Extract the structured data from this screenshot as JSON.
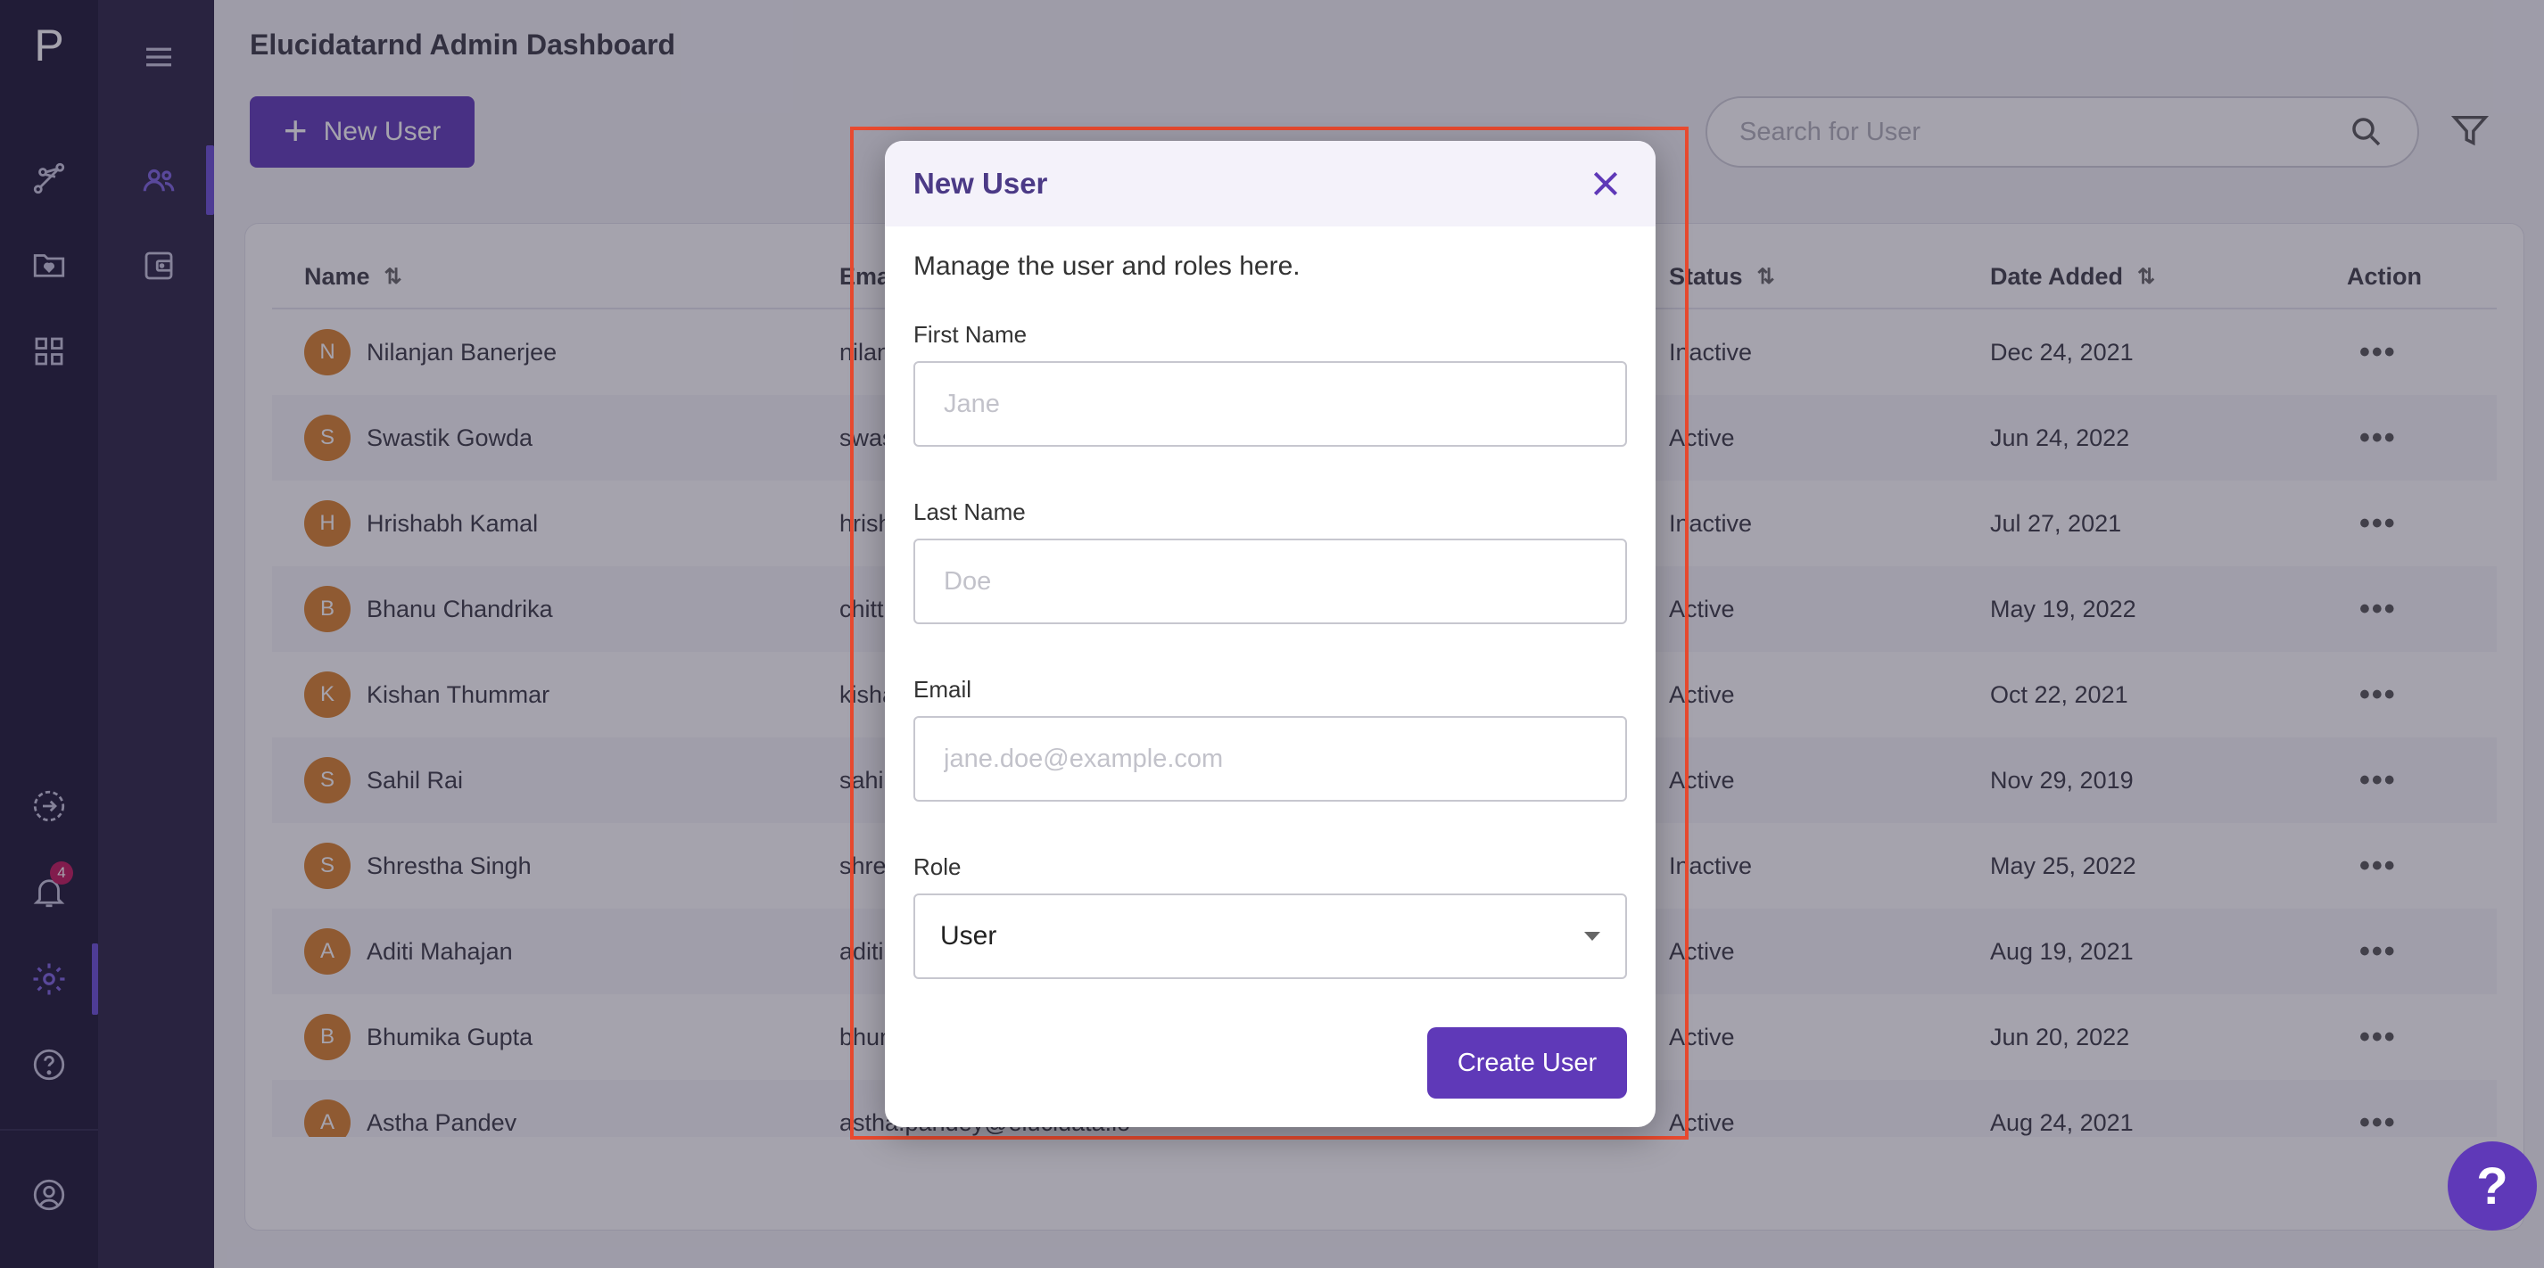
{
  "brand": {
    "logo_letter": "P"
  },
  "rail": {
    "notification_count": "4"
  },
  "header": {
    "title": "Elucidatarnd Admin Dashboard",
    "new_user_label": "New User",
    "search_placeholder": "Search for User"
  },
  "table": {
    "columns": [
      "Name",
      "Email",
      "Status",
      "Date Added",
      "Action"
    ],
    "rows": [
      {
        "initial": "N",
        "name": "Nilanjan Banerjee",
        "email": "nilan",
        "status": "Inactive",
        "date": "Dec 24, 2021"
      },
      {
        "initial": "S",
        "name": "Swastik Gowda",
        "email": "swas",
        "status": "Active",
        "date": "Jun 24, 2022"
      },
      {
        "initial": "H",
        "name": "Hrishabh Kamal",
        "email": "hrish",
        "status": "Inactive",
        "date": "Jul 27, 2021"
      },
      {
        "initial": "B",
        "name": "Bhanu Chandrika",
        "email": "chitt",
        "status": "Active",
        "date": "May 19, 2022"
      },
      {
        "initial": "K",
        "name": "Kishan Thummar",
        "email": "kisha",
        "status": "Active",
        "date": "Oct 22, 2021"
      },
      {
        "initial": "S",
        "name": "Sahil Rai",
        "email": "sahil",
        "status": "Active",
        "date": "Nov 29, 2019"
      },
      {
        "initial": "S",
        "name": "Shrestha Singh",
        "email": "shres",
        "status": "Inactive",
        "date": "May 25, 2022"
      },
      {
        "initial": "A",
        "name": "Aditi Mahajan",
        "email": "aditi.",
        "status": "Active",
        "date": "Aug 19, 2021"
      },
      {
        "initial": "B",
        "name": "Bhumika Gupta",
        "email": "bhum",
        "status": "Active",
        "date": "Jun 20, 2022"
      },
      {
        "initial": "A",
        "name": "Astha Pandev",
        "email": "astha.pandey@elucidata.io",
        "status": "Active",
        "date": "Aug 24, 2021"
      }
    ],
    "action_glyph": "•••"
  },
  "modal": {
    "title": "New User",
    "description": "Manage the user and roles here.",
    "first_name_label": "First Name",
    "first_name_placeholder": "Jane",
    "last_name_label": "Last Name",
    "last_name_placeholder": "Doe",
    "email_label": "Email",
    "email_placeholder": "jane.doe@example.com",
    "role_label": "Role",
    "role_value": "User",
    "submit_label": "Create User"
  },
  "help_fab": {
    "label": "?"
  },
  "colors": {
    "accent": "#5f39b8",
    "rail_bg": "#1d1835",
    "highlight": "#e84a2f",
    "avatar": "#d9822b"
  }
}
